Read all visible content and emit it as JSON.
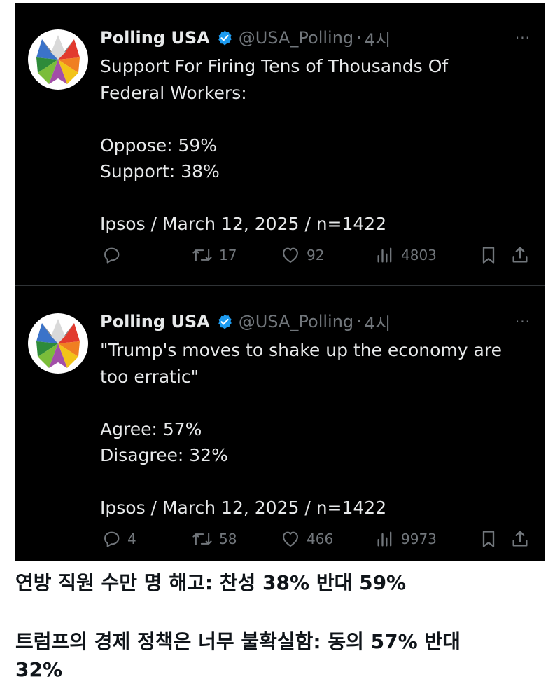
{
  "tweets": [
    {
      "author_name": "Polling USA",
      "handle": "@USA_Polling",
      "separator": "·",
      "time": "4시",
      "more": "···",
      "lines": [
        "Support For Firing Tens of Thousands Of",
        "Federal Workers:"
      ],
      "results": [
        "Oppose: 59%",
        "Support: 38%"
      ],
      "source": "Ipsos / March 12, 2025 / n=1422",
      "stats": {
        "replies": "",
        "reposts": "17",
        "likes": "92",
        "views": "4803"
      }
    },
    {
      "author_name": "Polling USA",
      "handle": "@USA_Polling",
      "separator": "·",
      "time": "4시",
      "more": "···",
      "lines": [
        "\"Trump's moves to shake up the economy are",
        "too erratic\""
      ],
      "results": [
        "Agree: 57%",
        "Disagree: 32%"
      ],
      "source": "Ipsos / March 12, 2025 / n=1422",
      "stats": {
        "replies": "4",
        "reposts": "58",
        "likes": "466",
        "views": "9973"
      }
    }
  ],
  "captions": {
    "line1": "연방 직원 수만 명 해고: 찬성 38% 반대 59%",
    "line2": "트럼프의 경제 정책은 너무 불확실함: 동의 57% 반대",
    "line3": "32%"
  },
  "colors": {
    "background": "#000000",
    "text": "#e7e9ea",
    "muted": "#71767b",
    "verified": "#1d9bf0"
  }
}
